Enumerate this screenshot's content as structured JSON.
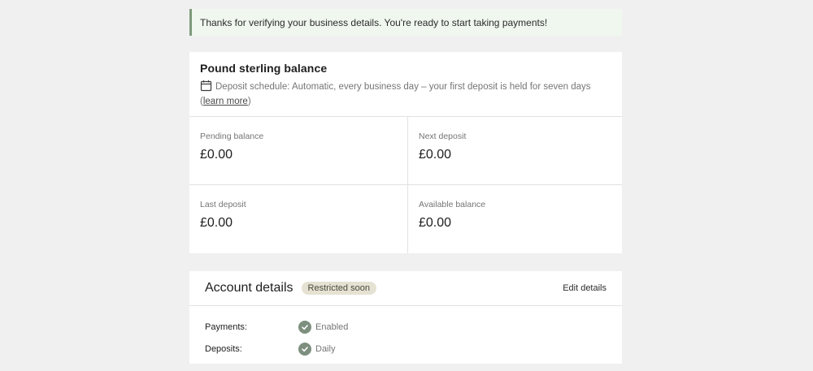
{
  "notice": {
    "text": "Thanks for verifying your business details. You're ready to start taking payments!"
  },
  "balance": {
    "title": "Pound sterling balance",
    "schedule_text": "Deposit schedule: Automatic, every business day – your first deposit is held for seven days (",
    "learn_more": "learn more",
    "schedule_close": ")",
    "cells": [
      {
        "label": "Pending balance",
        "value": "£0.00"
      },
      {
        "label": "Next deposit",
        "value": "£0.00"
      },
      {
        "label": "Last deposit",
        "value": "£0.00"
      },
      {
        "label": "Available balance",
        "value": "£0.00"
      }
    ]
  },
  "account": {
    "title": "Account details",
    "badge": "Restricted soon",
    "edit_label": "Edit details",
    "rows": [
      {
        "label": "Payments:",
        "value": "Enabled",
        "icon": "check-circle-icon"
      },
      {
        "label": "Deposits:",
        "value": "Daily",
        "icon": "check-circle-icon"
      }
    ]
  },
  "colors": {
    "page_background": "#f0f0f0",
    "notice_background": "#eff7ee",
    "notice_border": "#7d9a7b",
    "badge_background": "#e5e2d3",
    "check_icon": "#7d8f7e"
  }
}
